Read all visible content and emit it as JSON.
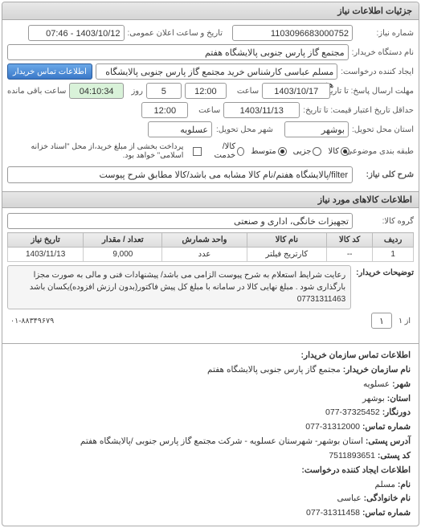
{
  "panel_title": "جزئیات اطلاعات نیاز",
  "top": {
    "need_no_label": "شماره نیاز:",
    "need_no": "1103096683000752",
    "pub_date_label": "تاریخ و ساعت اعلان عمومی:",
    "pub_date": "1403/10/12 - 07:46",
    "buyer_org_label": "نام دستگاه خریدار:",
    "buyer_org": "مجتمع گاز پارس جنوبی  پالایشگاه هفتم",
    "requester_label": "ایجاد کننده درخواست:",
    "requester": "مسلم عباسی کارشناس خرید مجتمع گاز پارس جنوبی  پالایشگاه هفتم",
    "contact_btn": "اطلاعات تماس خریدار",
    "deadline_reply_label": "مهلت ارسال پاسخ: تا تاریخ:",
    "deadline_reply_date": "1403/10/17",
    "hour_label": "ساعت",
    "deadline_reply_time": "12:00",
    "remain_days": "5",
    "day_word": "روز",
    "countdown": "04:10:34",
    "remain_label": "ساعت باقی مانده",
    "credit_until_label": "حداقل تاریخ اعتبار قیمت: تا تاریخ:",
    "credit_date": "1403/11/13",
    "credit_time": "12:00",
    "province_label": "استان محل تحویل:",
    "city_label": "شهر محل تحویل:",
    "province": "بوشهر",
    "city": "عسلویه",
    "pkg_label": "طبقه بندی موضوعی:",
    "pkg_all": "کالا",
    "pkg_part": "جزیی",
    "pkg_mid": "متوسط",
    "pay_label": "کالا/خدمت",
    "pay_check": "پرداخت بخشی از مبلغ خرید،از محل \"اسناد خزانه اسلامی\" خواهد بود.",
    "sharh_label": "شرح کلی نیاز:",
    "sharh": "filter/پالایشگاه هفتم/نام کالا مشابه می باشد/کالا مطابق شرح پیوست"
  },
  "items_section": {
    "title": "اطلاعات کالاهای مورد نیاز",
    "group_label": "گروه کالا:",
    "group": "تجهیزات خانگی، اداری و صنعتی",
    "headers": {
      "row": "ردیف",
      "code": "کد کالا",
      "name": "نام کالا",
      "unit": "واحد شمارش",
      "qty": "تعداد / مقدار",
      "date": "تاریخ نیاز"
    },
    "rows": [
      {
        "row": "1",
        "code": "--",
        "name": "کارتریج فیلتر",
        "unit": "عدد",
        "qty": "9,000",
        "date": "1403/11/13"
      }
    ],
    "desc_label": "توضیحات خریدار:",
    "desc": "رعایت شرایط استعلام به شرح پیوست الزامی می باشد/ پیشنهادات فنی و مالی به صورت مجزا بارگذاری شود . مبلغ نهایی کالا در سامانه با مبلغ کل پیش فاکتور(بدون ارزش افزوده)یکسان باشد 07731311463",
    "page": "از ۱",
    "page_input": "۱",
    "url": "۰۱-۸۸۳۴۹۶۷۹"
  },
  "contact": {
    "title": "اطلاعات تماس سازمان خریدار:",
    "org_label": "نام سازمان خریدار:",
    "org": "مجتمع گاز پارس جنوبی پالایشگاه هفتم",
    "city_label": "شهر:",
    "city": "عسلویه",
    "province_label": "استان:",
    "province": "بوشهر",
    "fax_label": "دورنگار:",
    "fax": "37325452-077",
    "phone_label": "شماره تماس:",
    "phone": "31312000-077",
    "addr_label": "آدرس پستی:",
    "addr": "استان بوشهر- شهرستان عسلویه - شرکت مجتمع گاز پارس جنوبی /پالایشگاه هفتم",
    "post_label": "کد پستی:",
    "post": "7511893651",
    "title2": "اطلاعات ایجاد کننده درخواست:",
    "name_label": "نام:",
    "name": "مسلم",
    "lname_label": "نام خانوادگی:",
    "lname": "عباسی",
    "phone2_label": "شماره تماس:",
    "phone2": "31311458-077"
  }
}
